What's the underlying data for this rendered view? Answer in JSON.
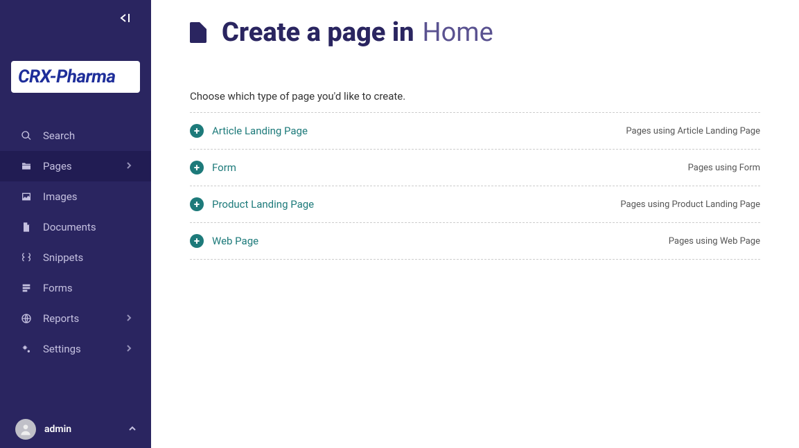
{
  "logo_text": "CRX-Pharma",
  "sidebar": {
    "items": [
      {
        "label": "Search",
        "icon": "search",
        "has_children": false,
        "active": false
      },
      {
        "label": "Pages",
        "icon": "folder",
        "has_children": true,
        "active": true
      },
      {
        "label": "Images",
        "icon": "image",
        "has_children": false,
        "active": false
      },
      {
        "label": "Documents",
        "icon": "file",
        "has_children": false,
        "active": false
      },
      {
        "label": "Snippets",
        "icon": "snippets",
        "has_children": false,
        "active": false
      },
      {
        "label": "Forms",
        "icon": "form",
        "has_children": false,
        "active": false
      },
      {
        "label": "Reports",
        "icon": "globe",
        "has_children": true,
        "active": false
      },
      {
        "label": "Settings",
        "icon": "cogs",
        "has_children": true,
        "active": false
      }
    ]
  },
  "user": {
    "name": "admin"
  },
  "header": {
    "title_prefix": "Create a page in",
    "parent_page": "Home"
  },
  "subtitle": "Choose which type of page you'd like to create.",
  "page_types": [
    {
      "label": "Article Landing Page",
      "meta": "Pages using Article Landing Page"
    },
    {
      "label": "Form",
      "meta": "Pages using Form"
    },
    {
      "label": "Product Landing Page",
      "meta": "Pages using Product Landing Page"
    },
    {
      "label": "Web Page",
      "meta": "Pages using Web Page"
    }
  ]
}
